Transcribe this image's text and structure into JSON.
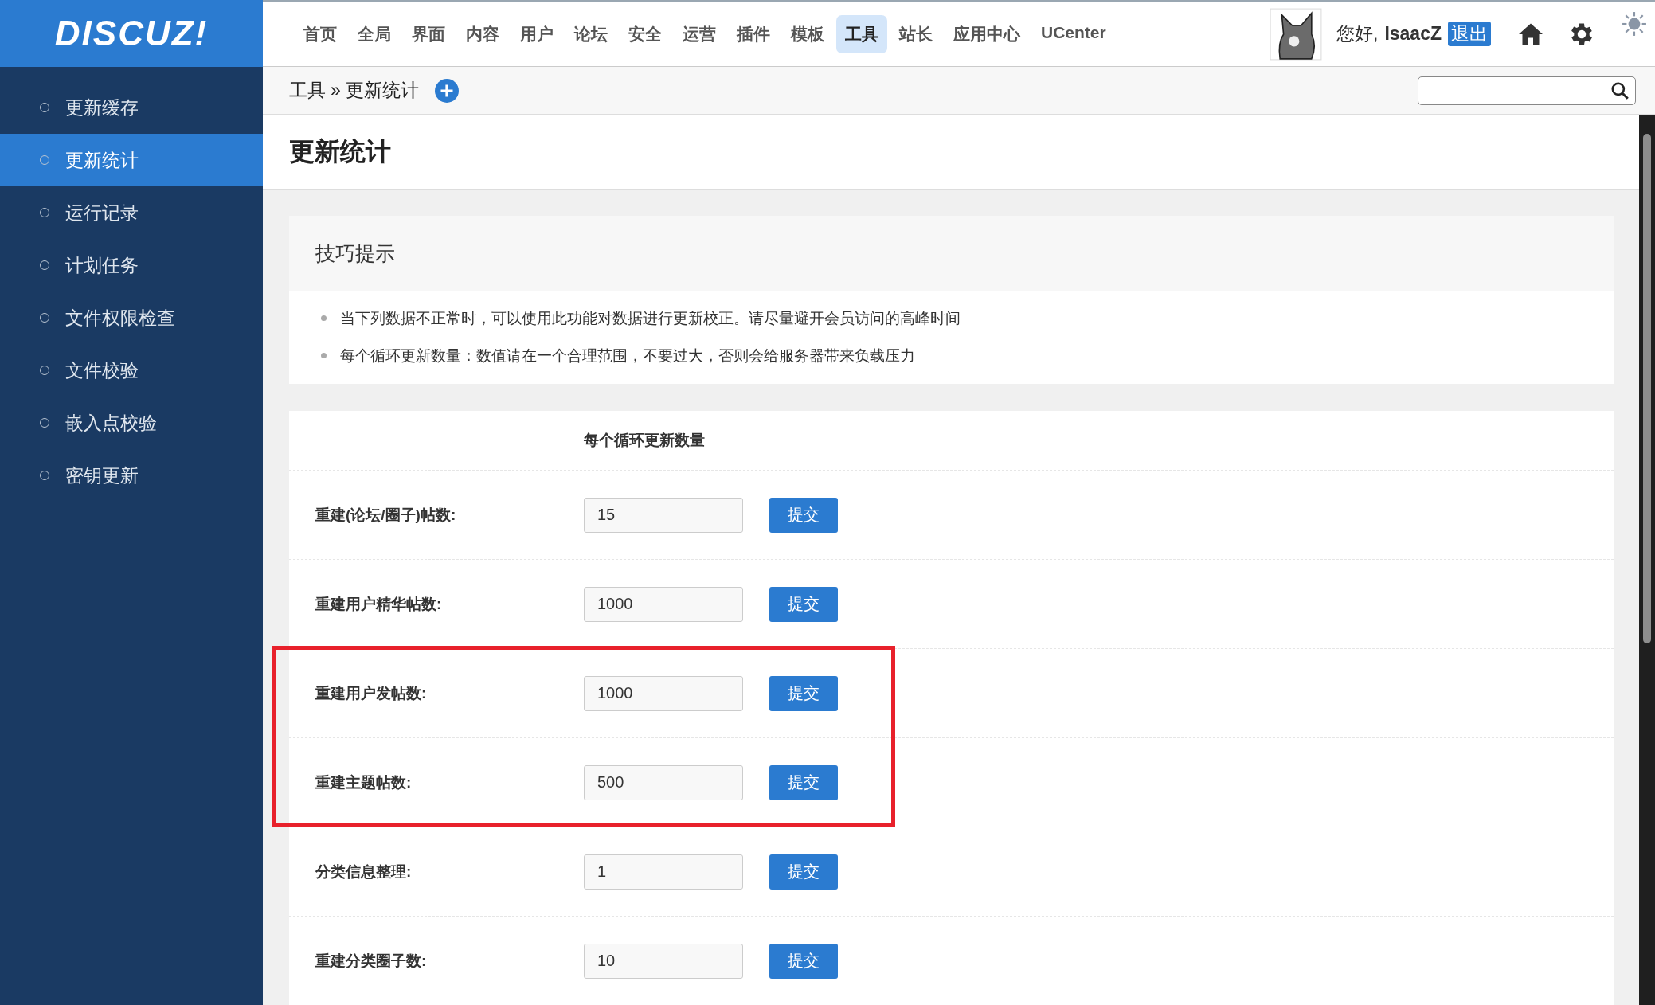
{
  "logo": "DISCUZ!",
  "top_nav": [
    {
      "label": "首页",
      "selected": false
    },
    {
      "label": "全局",
      "selected": false
    },
    {
      "label": "界面",
      "selected": false
    },
    {
      "label": "内容",
      "selected": false
    },
    {
      "label": "用户",
      "selected": false
    },
    {
      "label": "论坛",
      "selected": false
    },
    {
      "label": "安全",
      "selected": false
    },
    {
      "label": "运营",
      "selected": false
    },
    {
      "label": "插件",
      "selected": false
    },
    {
      "label": "模板",
      "selected": false
    },
    {
      "label": "工具",
      "selected": true
    },
    {
      "label": "站长",
      "selected": false
    },
    {
      "label": "应用中心",
      "selected": false
    },
    {
      "label": "UCenter",
      "selected": false
    }
  ],
  "user": {
    "greeting": "您好,",
    "name": "IsaacZ",
    "logout": "退出"
  },
  "breadcrumb": {
    "section": "工具",
    "separator": "»",
    "page": "更新统计"
  },
  "sidebar": {
    "items": [
      {
        "label": "更新缓存",
        "selected": false
      },
      {
        "label": "更新统计",
        "selected": true
      },
      {
        "label": "运行记录",
        "selected": false
      },
      {
        "label": "计划任务",
        "selected": false
      },
      {
        "label": "文件权限检查",
        "selected": false
      },
      {
        "label": "文件校验",
        "selected": false
      },
      {
        "label": "嵌入点校验",
        "selected": false
      },
      {
        "label": "密钥更新",
        "selected": false
      }
    ]
  },
  "page_title": "更新统计",
  "tips": {
    "title": "技巧提示",
    "items": [
      "当下列数据不正常时，可以使用此功能对数据进行更新校正。请尽量避开会员访问的高峰时间",
      "每个循环更新数量：数值请在一个合理范围，不要过大，否则会给服务器带来负载压力"
    ]
  },
  "table": {
    "column_header": "每个循环更新数量",
    "rows": [
      {
        "label": "重建(论坛/圈子)帖数:",
        "value": "15",
        "button": "提交",
        "highlighted": false
      },
      {
        "label": "重建用户精华帖数:",
        "value": "1000",
        "button": "提交",
        "highlighted": false
      },
      {
        "label": "重建用户发帖数:",
        "value": "1000",
        "button": "提交",
        "highlighted": true
      },
      {
        "label": "重建主题帖数:",
        "value": "500",
        "button": "提交",
        "highlighted": true
      },
      {
        "label": "分类信息整理:",
        "value": "1",
        "button": "提交",
        "highlighted": false
      },
      {
        "label": "重建分类圈子数:",
        "value": "10",
        "button": "提交",
        "highlighted": false
      }
    ]
  }
}
